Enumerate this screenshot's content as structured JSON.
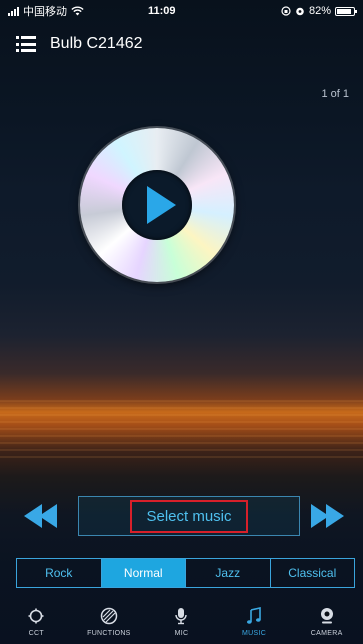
{
  "status_bar": {
    "carrier": "中国移动",
    "time": "11:09",
    "battery": "82%"
  },
  "header": {
    "title": "Bulb C21462"
  },
  "page_indicator": "1 of 1",
  "player": {
    "select_music": "Select music"
  },
  "genres": [
    {
      "label": "Rock",
      "active": false
    },
    {
      "label": "Normal",
      "active": true
    },
    {
      "label": "Jazz",
      "active": false
    },
    {
      "label": "Classical",
      "active": false
    }
  ],
  "tabs": [
    {
      "label": "CCT",
      "icon": "cct-icon",
      "active": false
    },
    {
      "label": "FUNCTIONS",
      "icon": "functions-icon",
      "active": false
    },
    {
      "label": "MIC",
      "icon": "mic-icon",
      "active": false
    },
    {
      "label": "MUSIC",
      "icon": "music-icon",
      "active": true
    },
    {
      "label": "CAMERA",
      "icon": "camera-icon",
      "active": false
    }
  ],
  "colors": {
    "accent": "#39a8e6",
    "active_tab_fill": "#1ea6e0",
    "highlight_border": "#d7202a"
  }
}
